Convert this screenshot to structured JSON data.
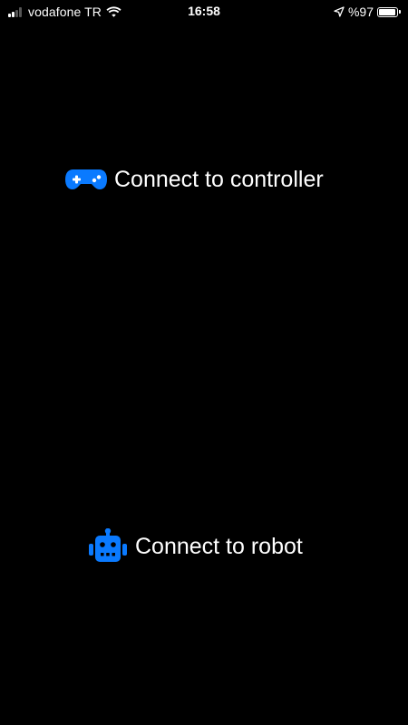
{
  "status_bar": {
    "carrier": "vodafone TR",
    "time": "16:58",
    "battery_percent": "%97",
    "battery_level": 0.97,
    "signal_bars_filled": 2,
    "signal_bars_total": 4,
    "icons": [
      "signal-icon",
      "wifi-icon",
      "location-arrow-icon",
      "battery-icon"
    ]
  },
  "main": {
    "controller_button": {
      "label": "Connect to controller",
      "icon": "gamepad-icon"
    },
    "robot_button": {
      "label": "Connect to robot",
      "icon": "robot-icon"
    }
  },
  "colors": {
    "background": "#000000",
    "text": "#ffffff",
    "accent": "#0a7aff"
  }
}
